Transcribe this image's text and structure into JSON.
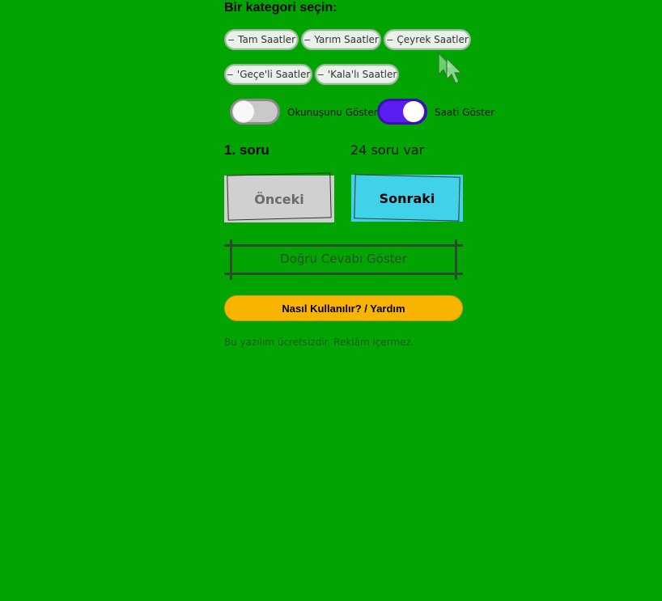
{
  "category_heading": "Bir kategori seçin:",
  "categories": [
    {
      "label": "Tam Saatler",
      "prefix": "−"
    },
    {
      "label": "Yarım Saatler",
      "prefix": "−"
    },
    {
      "label": "Çeyrek Saatler",
      "prefix": "−"
    },
    {
      "label": "'Geçe'li Saatler",
      "prefix": "−"
    },
    {
      "label": "'Kala'lı Saatler",
      "prefix": "−"
    }
  ],
  "toggles": {
    "reading": {
      "label": "Okunuşunu Göster",
      "on": false
    },
    "time": {
      "label": "Saati Göster",
      "on": true
    }
  },
  "question": {
    "number_label": "1. soru",
    "count_label": "24 soru var"
  },
  "nav": {
    "prev_label": "Önceki",
    "next_label": "Sonraki"
  },
  "answer_label": "Doğru Cevabı Göster",
  "help_label": "Nasıl Kullanılır? / Yardım",
  "footer_note": "Bu yazılım ücretsizdir. Reklâm içermez.",
  "colors": {
    "background": "#01a400",
    "next_button": "#3fd2e8",
    "toggle_on": "#5a1ff0",
    "help_button": "#f8b400"
  },
  "icons": {
    "cursor": "mouse-pointer-icon"
  }
}
